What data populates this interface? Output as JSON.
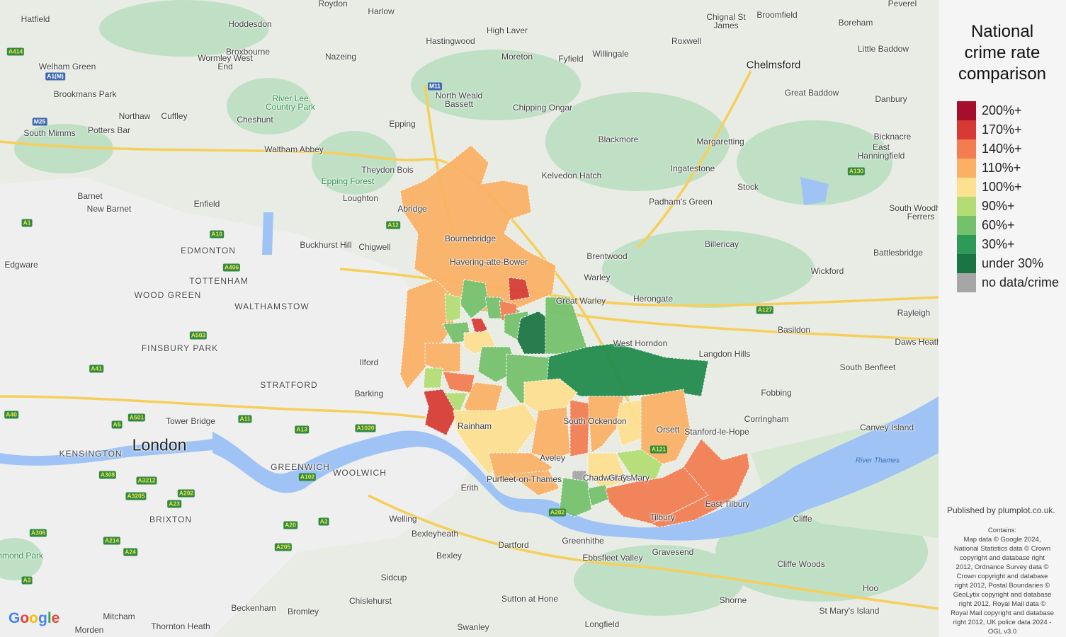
{
  "legend": {
    "title": "National crime rate comparison",
    "title_lines": [
      "National",
      "crime rate",
      "comparison"
    ],
    "items": [
      {
        "label": "200%+",
        "color": "#a50f2d"
      },
      {
        "label": "170%+",
        "color": "#d73a33"
      },
      {
        "label": "140%+",
        "color": "#f27d51"
      },
      {
        "label": "110%+",
        "color": "#fbb064"
      },
      {
        "label": "100%+",
        "color": "#fde090"
      },
      {
        "label": "90%+",
        "color": "#b3dd73"
      },
      {
        "label": "60%+",
        "color": "#74c06b"
      },
      {
        "label": "30%+",
        "color": "#2e9a57"
      },
      {
        "label": "under 30%",
        "color": "#1a7443"
      },
      {
        "label": "no data/crime",
        "color": "#a6a6a6"
      }
    ]
  },
  "published": "Published by plumplot.co.uk.",
  "contains_lines": [
    "Contains:",
    "Map data © Google 2024,",
    "National Statistics data © Crown",
    "copyright and database right",
    "2012, Ordnance Survey data ©",
    "Crown copyright and database",
    "right 2012, Postal Boundaries ©",
    "GeoLytix copyright and database",
    "right 2012, Royal Mail data ©",
    "Royal Mail copyright and database",
    "right 2012, UK police data 2024 -",
    "OGL v3.0"
  ],
  "map": {
    "google_logo": "Google",
    "places": [
      {
        "name": "Roydon"
      },
      {
        "name": "Harlow"
      },
      {
        "name": "Hatfield"
      },
      {
        "name": "Hoddesdon"
      },
      {
        "name": "High Laver"
      },
      {
        "name": "Hastingwood"
      },
      {
        "name": "Chignal St James"
      },
      {
        "name": "Broomfield"
      },
      {
        "name": "Boreham"
      },
      {
        "name": "Peverel"
      },
      {
        "name": "Welham Green"
      },
      {
        "name": "Broxbourne"
      },
      {
        "name": "Wormley West End"
      },
      {
        "name": "Nazeing"
      },
      {
        "name": "Moreton"
      },
      {
        "name": "Fyfield"
      },
      {
        "name": "Willingale"
      },
      {
        "name": "Roxwell"
      },
      {
        "name": "Little Baddow"
      },
      {
        "name": "Chelmsford"
      },
      {
        "name": "Brookmans Park"
      },
      {
        "name": "North Weald Bassett"
      },
      {
        "name": "Great Baddow"
      },
      {
        "name": "Danbury"
      },
      {
        "name": "Chipping Ongar"
      },
      {
        "name": "River Lee Country Park"
      },
      {
        "name": "Northaw"
      },
      {
        "name": "Cuffley"
      },
      {
        "name": "Potters Bar"
      },
      {
        "name": "South Mimms"
      },
      {
        "name": "Cheshunt"
      },
      {
        "name": "Epping"
      },
      {
        "name": "Blackmore"
      },
      {
        "name": "Margaretting"
      },
      {
        "name": "Bicknacre"
      },
      {
        "name": "Waltham Abbey"
      },
      {
        "name": "East Hanningfield"
      },
      {
        "name": "Theydon Bois"
      },
      {
        "name": "Kelvedon Hatch"
      },
      {
        "name": "Ingatestone"
      },
      {
        "name": "Epping Forest"
      },
      {
        "name": "Stock"
      },
      {
        "name": "Barnet"
      },
      {
        "name": "Loughton"
      },
      {
        "name": "Padham's Green"
      },
      {
        "name": "New Barnet"
      },
      {
        "name": "Abridge"
      },
      {
        "name": "Enfield"
      },
      {
        "name": "South Woodham Ferrers"
      },
      {
        "name": "Bournebridge"
      },
      {
        "name": "Billericay"
      },
      {
        "name": "Buckhurst Hill"
      },
      {
        "name": "Chigwell"
      },
      {
        "name": "EDMONTON"
      },
      {
        "name": "Brentwood"
      },
      {
        "name": "Battlesbridge"
      },
      {
        "name": "Havering-atte-Bower"
      },
      {
        "name": "Edgware"
      },
      {
        "name": "Wickford"
      },
      {
        "name": "Warley"
      },
      {
        "name": "TOTTENHAM"
      },
      {
        "name": "WOOD GREEN"
      },
      {
        "name": "Great Warley"
      },
      {
        "name": "Herongate"
      },
      {
        "name": "WALTHAMSTOW"
      },
      {
        "name": "Rayleigh"
      },
      {
        "name": "Basildon"
      },
      {
        "name": "West Horndon"
      },
      {
        "name": "Daws Heath"
      },
      {
        "name": "FINSBURY PARK"
      },
      {
        "name": "Langdon Hills"
      },
      {
        "name": "Ilford"
      },
      {
        "name": "South Benfleet"
      },
      {
        "name": "STRATFORD"
      },
      {
        "name": "Barking"
      },
      {
        "name": "Fobbing"
      },
      {
        "name": "Corringham"
      },
      {
        "name": "Tower Bridge"
      },
      {
        "name": "Rainham"
      },
      {
        "name": "South Ockendon"
      },
      {
        "name": "Orsett"
      },
      {
        "name": "Canvey Island"
      },
      {
        "name": "London"
      },
      {
        "name": "KENSINGTON"
      },
      {
        "name": "Stanford-le-Hope"
      },
      {
        "name": "River Thames"
      },
      {
        "name": "GREENWICH"
      },
      {
        "name": "WOOLWICH"
      },
      {
        "name": "Aveley"
      },
      {
        "name": "Erith"
      },
      {
        "name": "Purfleet-on-Thames"
      },
      {
        "name": "Chadwell St Mary"
      },
      {
        "name": "East Tilbury"
      },
      {
        "name": "BRIXTON"
      },
      {
        "name": "Welling"
      },
      {
        "name": "Tilbury"
      },
      {
        "name": "Cliffe"
      },
      {
        "name": "Bexleyheath"
      },
      {
        "name": "Greenhithe"
      },
      {
        "name": "Richmond Park"
      },
      {
        "name": "Dartford"
      },
      {
        "name": "Gravesend"
      },
      {
        "name": "Bexley"
      },
      {
        "name": "Ebbsfleet Valley"
      },
      {
        "name": "Cliffe Woods"
      },
      {
        "name": "Sidcup"
      },
      {
        "name": "Chislehurst"
      },
      {
        "name": "Sutton at Hone"
      },
      {
        "name": "Shorne"
      },
      {
        "name": "Hoo"
      },
      {
        "name": "Beckenham"
      },
      {
        "name": "Bromley"
      },
      {
        "name": "Mitcham"
      },
      {
        "name": "St Mary's Island"
      },
      {
        "name": "Morden"
      },
      {
        "name": "Thornton Heath"
      },
      {
        "name": "Swanley"
      },
      {
        "name": "Longfield"
      },
      {
        "name": "Grays"
      }
    ],
    "roads": [
      "A414",
      "A1(M)",
      "M25",
      "A12",
      "A130",
      "M11",
      "A10",
      "A406",
      "A1",
      "A503",
      "A41",
      "A40",
      "A501",
      "A5",
      "A11",
      "A13",
      "A1020",
      "A102",
      "A2",
      "A20",
      "A205",
      "A24",
      "A3",
      "A306",
      "A214",
      "A282",
      "A308",
      "A3212",
      "A3205",
      "A202",
      "A23",
      "A127",
      "A121"
    ]
  }
}
